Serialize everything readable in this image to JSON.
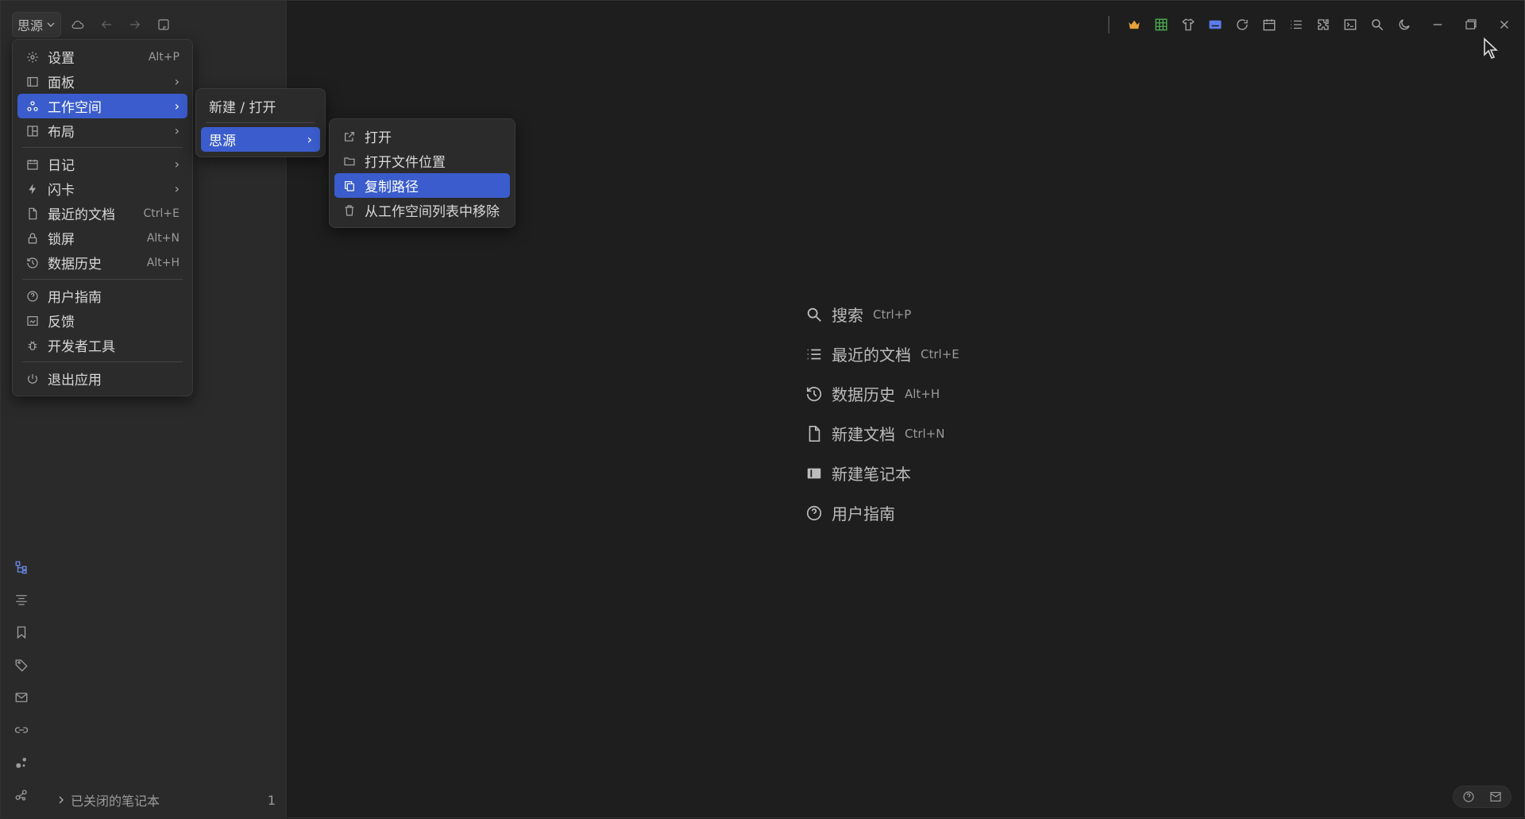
{
  "workspace": {
    "name": "思源"
  },
  "menu_main": {
    "items": [
      {
        "label": "设置",
        "shortcut": "Alt+P"
      },
      {
        "label": "面板"
      },
      {
        "label": "工作空间"
      },
      {
        "label": "布局"
      },
      {
        "label": "日记"
      },
      {
        "label": "闪卡"
      },
      {
        "label": "最近的文档",
        "shortcut": "Ctrl+E"
      },
      {
        "label": "锁屏",
        "shortcut": "Alt+N"
      },
      {
        "label": "数据历史",
        "shortcut": "Alt+H"
      },
      {
        "label": "用户指南"
      },
      {
        "label": "反馈"
      },
      {
        "label": "开发者工具"
      },
      {
        "label": "退出应用"
      }
    ]
  },
  "menu_workspace": {
    "items": [
      {
        "label": "新建 / 打开"
      },
      {
        "label": "思源"
      }
    ]
  },
  "menu_siyuan": {
    "items": [
      {
        "label": "打开"
      },
      {
        "label": "打开文件位置"
      },
      {
        "label": "复制路径"
      },
      {
        "label": "从工作空间列表中移除"
      }
    ]
  },
  "empty_state": {
    "items": [
      {
        "label": "搜索",
        "shortcut": "Ctrl+P",
        "icon": "search-icon"
      },
      {
        "label": "最近的文档",
        "shortcut": "Ctrl+E",
        "icon": "list-icon"
      },
      {
        "label": "数据历史",
        "shortcut": "Alt+H",
        "icon": "history-icon"
      },
      {
        "label": "新建文档",
        "shortcut": "Ctrl+N",
        "icon": "file-icon"
      },
      {
        "label": "新建笔记本",
        "shortcut": "",
        "icon": "notebook-icon"
      },
      {
        "label": "用户指南",
        "shortcut": "",
        "icon": "help-icon"
      }
    ]
  },
  "sidebar": {
    "closed_notebooks_label": "已关闭的笔记本",
    "closed_notebooks_count": "1"
  },
  "colors": {
    "accent": "#3a5ccc",
    "background": "#1e1e1e",
    "sidebar": "#2a2a2a"
  }
}
